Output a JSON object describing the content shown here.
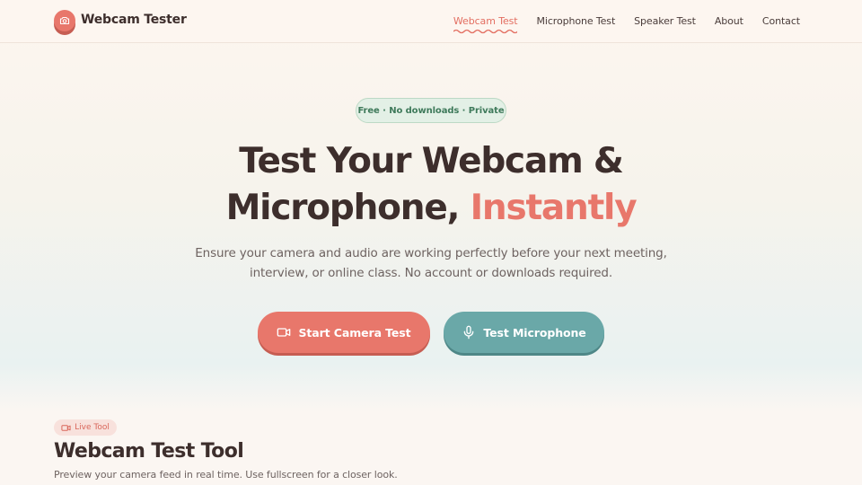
{
  "header": {
    "brand_name": "Webcam Tester",
    "brand_icon": "camera-icon",
    "nav": [
      {
        "label": "Webcam Test",
        "active": true
      },
      {
        "label": "Microphone Test",
        "active": false
      },
      {
        "label": "Speaker Test",
        "active": false
      },
      {
        "label": "About",
        "active": false
      },
      {
        "label": "Contact",
        "active": false
      }
    ]
  },
  "hero": {
    "badge": "Free · No downloads · Private",
    "title_line1": "Test Your Webcam &",
    "title_line2_main": "Microphone, ",
    "title_line2_accent": "Instantly",
    "subtitle": "Ensure your camera and audio are working perfectly before your next meeting, interview, or online class. No account or downloads required.",
    "primary_button": {
      "label": "Start Camera Test",
      "icon": "video-camera-icon"
    },
    "secondary_button": {
      "label": "Test Microphone",
      "icon": "microphone-icon"
    }
  },
  "tool_section": {
    "pill": "Live Tool",
    "pill_icon": "video-camera-icon",
    "title": "Webcam Test Tool",
    "description": "Preview your camera feed in real time. Use fullscreen for a closer look."
  },
  "colors": {
    "accent": "#e8776b",
    "teal": "#6aa8a8",
    "text": "#3d2e2c",
    "badge_green": "#3f7a5b"
  }
}
